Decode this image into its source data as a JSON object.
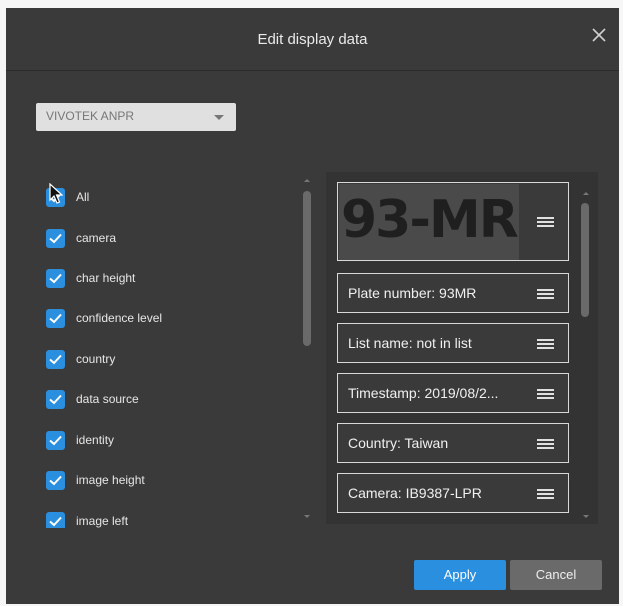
{
  "dialog": {
    "title": "Edit display data",
    "close_icon": "close-icon"
  },
  "source_select": {
    "value": "VIVOTEK ANPR",
    "icon": "chevron-down-icon"
  },
  "fields": [
    {
      "label": "All",
      "checked": true
    },
    {
      "label": "camera",
      "checked": true
    },
    {
      "label": "char height",
      "checked": true
    },
    {
      "label": "confidence level",
      "checked": true
    },
    {
      "label": "country",
      "checked": true
    },
    {
      "label": "data source",
      "checked": true
    },
    {
      "label": "identity",
      "checked": true
    },
    {
      "label": "image height",
      "checked": true
    },
    {
      "label": "image left",
      "checked": true
    }
  ],
  "preview": {
    "plate_image_text": "93-MR",
    "cards": [
      {
        "label": "Plate number: 93MR"
      },
      {
        "label": "List name: not in list"
      },
      {
        "label": "Timestamp: 2019/08/2..."
      },
      {
        "label": "Country: Taiwan"
      },
      {
        "label": "Camera: IB9387-LPR"
      }
    ],
    "handle_icon": "drag-handle-icon"
  },
  "footer": {
    "apply_label": "Apply",
    "cancel_label": "Cancel"
  },
  "colors": {
    "accent": "#2b8fe0",
    "dialog_bg": "#3a3a3a",
    "cancel_bg": "#6a6a6a"
  }
}
